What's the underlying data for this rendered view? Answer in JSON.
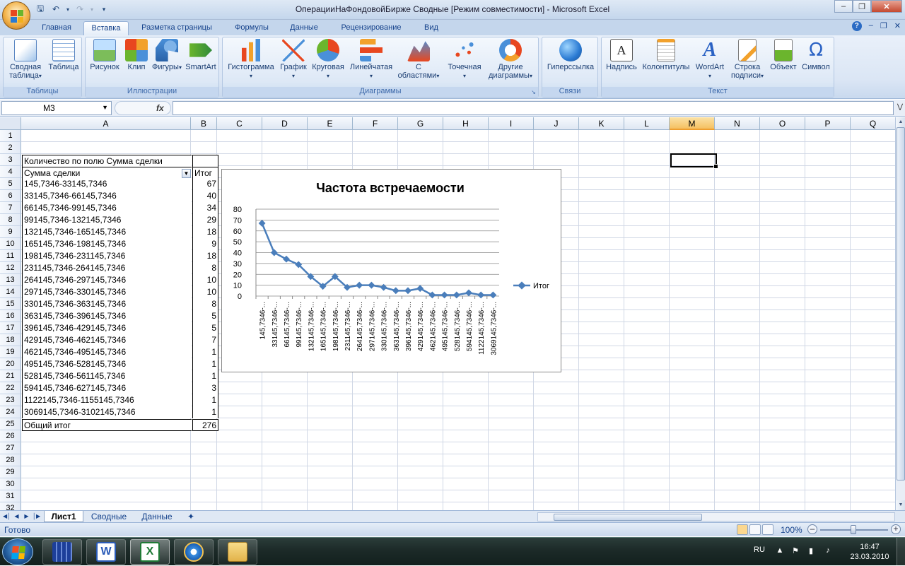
{
  "window": {
    "title": "ОперацииНаФондовойБирже  Сводные  [Режим совместимости] - Microsoft Excel"
  },
  "ribbon": {
    "tabs": [
      "Главная",
      "Вставка",
      "Разметка страницы",
      "Формулы",
      "Данные",
      "Рецензирование",
      "Вид"
    ],
    "active_tab": "Вставка",
    "groups": {
      "tables": {
        "label": "Таблицы",
        "buttons": [
          "Сводная\nтаблица",
          "Таблица"
        ]
      },
      "illustrations": {
        "label": "Иллюстрации",
        "buttons": [
          "Рисунок",
          "Клип",
          "Фигуры",
          "SmartArt"
        ]
      },
      "charts": {
        "label": "Диаграммы",
        "buttons": [
          "Гистограмма",
          "График",
          "Круговая",
          "Линейчатая",
          "С\nобластями",
          "Точечная",
          "Другие\nдиаграммы"
        ]
      },
      "links": {
        "label": "Связи",
        "buttons": [
          "Гиперссылка"
        ]
      },
      "text": {
        "label": "Текст",
        "buttons": [
          "Надпись",
          "Колонтитулы",
          "WordArt",
          "Строка\nподписи",
          "Объект",
          "Символ"
        ]
      }
    }
  },
  "formula_bar": {
    "name_box": "M3",
    "fx": "fx",
    "formula": ""
  },
  "columns": [
    "A",
    "B",
    "C",
    "D",
    "E",
    "F",
    "G",
    "H",
    "I",
    "J",
    "K",
    "L",
    "M",
    "N",
    "O",
    "P",
    "Q"
  ],
  "selected_column": "M",
  "rows": [
    "1",
    "2",
    "3",
    "4",
    "5",
    "6",
    "7",
    "8",
    "9",
    "10",
    "11",
    "12",
    "13",
    "14",
    "15",
    "16",
    "17",
    "18",
    "19",
    "20",
    "21",
    "22",
    "23",
    "24",
    "25",
    "26",
    "27",
    "28",
    "29",
    "30",
    "31",
    "32"
  ],
  "pivot": {
    "title": "Количество по полю Сумма сделки",
    "header_a": "Сумма сделки",
    "header_b": "Итог",
    "rows": [
      {
        "range": "145,7346-33145,7346",
        "count": "67"
      },
      {
        "range": "33145,7346-66145,7346",
        "count": "40"
      },
      {
        "range": "66145,7346-99145,7346",
        "count": "34"
      },
      {
        "range": "99145,7346-132145,7346",
        "count": "29"
      },
      {
        "range": "132145,7346-165145,7346",
        "count": "18"
      },
      {
        "range": "165145,7346-198145,7346",
        "count": "9"
      },
      {
        "range": "198145,7346-231145,7346",
        "count": "18"
      },
      {
        "range": "231145,7346-264145,7346",
        "count": "8"
      },
      {
        "range": "264145,7346-297145,7346",
        "count": "10"
      },
      {
        "range": "297145,7346-330145,7346",
        "count": "10"
      },
      {
        "range": "330145,7346-363145,7346",
        "count": "8"
      },
      {
        "range": "363145,7346-396145,7346",
        "count": "5"
      },
      {
        "range": "396145,7346-429145,7346",
        "count": "5"
      },
      {
        "range": "429145,7346-462145,7346",
        "count": "7"
      },
      {
        "range": "462145,7346-495145,7346",
        "count": "1"
      },
      {
        "range": "495145,7346-528145,7346",
        "count": "1"
      },
      {
        "range": "528145,7346-561145,7346",
        "count": "1"
      },
      {
        "range": "594145,7346-627145,7346",
        "count": "3"
      },
      {
        "range": "1122145,7346-1155145,7346",
        "count": "1"
      },
      {
        "range": "3069145,7346-3102145,7346",
        "count": "1"
      }
    ],
    "total_label": "Общий итог",
    "total": "276"
  },
  "chart_data": {
    "type": "line",
    "title": "Частота встречаемости",
    "categories": [
      "145,7346-...",
      "33145,7346-...",
      "66145,7346-...",
      "99145,7346-...",
      "132145,7346-...",
      "165145,7346-...",
      "198145,7346-...",
      "231145,7346-...",
      "264145,7346-...",
      "297145,7346-...",
      "330145,7346-...",
      "363145,7346-...",
      "396145,7346-...",
      "429145,7346-...",
      "462145,7346-...",
      "495145,7346-...",
      "528145,7346-...",
      "594145,7346-...",
      "1122145,7346-...",
      "3069145,7346-..."
    ],
    "visible_tick_labels": [
      "145,7346-...",
      "33145,7346-...",
      "66145,7346-...",
      "99145,7346-...",
      "132145,7346-...",
      "165145,7346-...",
      "198145,7346-...",
      "231145,7346-...",
      "264145,7346-...",
      "297145,7346-...",
      "330145,7346-...",
      "363145,7346-...",
      "396145,7346-...",
      "429145,7346-...",
      "462145,7346-...",
      "495145,7346-...",
      "528145,7346-...",
      "594145,7346-...",
      "1122145,7346-...",
      "3069145,7346-..."
    ],
    "series": [
      {
        "name": "Итог",
        "values": [
          67,
          40,
          34,
          29,
          18,
          9,
          18,
          8,
          10,
          10,
          8,
          5,
          5,
          7,
          1,
          1,
          1,
          3,
          1,
          1
        ]
      }
    ],
    "ylim": [
      0,
      80
    ],
    "yticks": [
      "0",
      "10",
      "20",
      "30",
      "40",
      "50",
      "60",
      "70",
      "80"
    ],
    "grid": true,
    "legend_position": "right",
    "line_color": "#4a7ebb"
  },
  "sheets": {
    "tabs": [
      "Лист1",
      "Сводные",
      "Данные"
    ],
    "active": "Лист1"
  },
  "status": {
    "ready": "Готово",
    "zoom": "100%"
  },
  "taskbar": {
    "lang": "RU",
    "time": "16:47",
    "date": "23.03.2010"
  }
}
